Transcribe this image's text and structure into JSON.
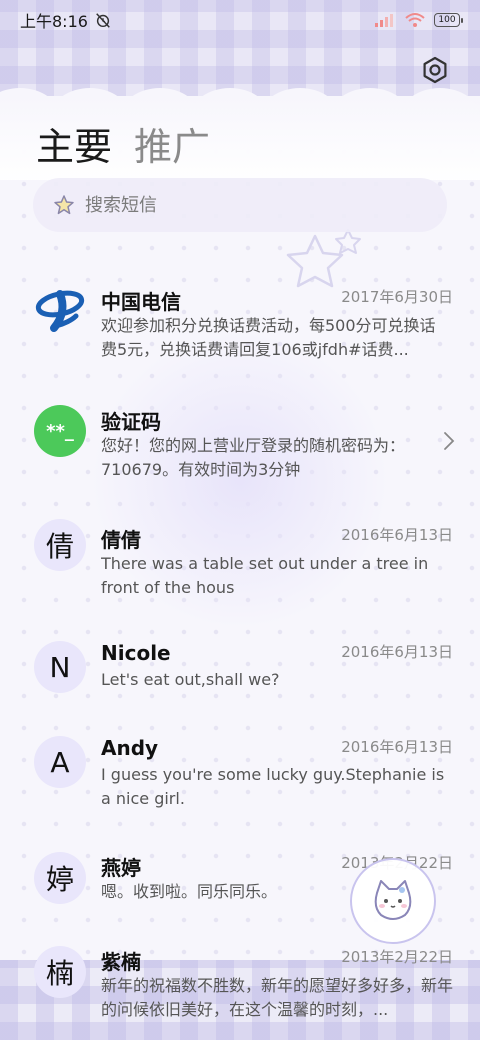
{
  "status_bar": {
    "time": "上午8:16",
    "battery": "100"
  },
  "tabs": [
    {
      "label": "主要",
      "active": true
    },
    {
      "label": "推广",
      "active": false
    }
  ],
  "search": {
    "placeholder": "搜索短信"
  },
  "conversations": [
    {
      "name": "中国电信",
      "date": "2017年6月30日",
      "preview": "欢迎参加积分兑换话费活动，每500分可兑换话费5元，兑换话费请回复106或jfdh#话费...",
      "avatar": "",
      "avatar_type": "telecom-logo"
    },
    {
      "name": "验证码",
      "date": "",
      "preview": "您好！您的网上营业厅登录的随机密码为：710679。有效时间为3分钟",
      "avatar": "**_",
      "avatar_type": "verification",
      "avatar_color": "#4cc95a"
    },
    {
      "name": "倩倩",
      "date": "2016年6月13日",
      "preview": "There was a table set out under a tree in front of the hous",
      "avatar": "倩",
      "avatar_type": "letter"
    },
    {
      "name": "Nicole",
      "date": "2016年6月13日",
      "preview": "Let's eat out,shall we?",
      "avatar": "N",
      "avatar_type": "letter"
    },
    {
      "name": "Andy",
      "date": "2016年6月13日",
      "preview": "I guess you're some lucky guy.Stephanie is a nice girl.",
      "avatar": "A",
      "avatar_type": "letter"
    },
    {
      "name": "燕婷",
      "date": "2013年2月22日",
      "preview": "嗯。收到啦。同乐同乐。",
      "avatar": "婷",
      "avatar_type": "letter"
    },
    {
      "name": "紫楠",
      "date": "2013年2月22日",
      "preview": "新年的祝福数不胜数，新年的愿望好多好多，新年的问候依旧美好，在这个温馨的时刻，...",
      "avatar": "楠",
      "avatar_type": "letter"
    }
  ],
  "colors": {
    "accent": "#c9c4ee",
    "avatar_bg": "#e9e6fb",
    "telecom_blue": "#1a5fb4",
    "verify_green": "#4cc95a"
  },
  "icons": {
    "settings": "hexagon-gear-icon",
    "search": "star-icon",
    "chevron": "chevron-right-icon",
    "compose": "cat-compose-icon"
  }
}
